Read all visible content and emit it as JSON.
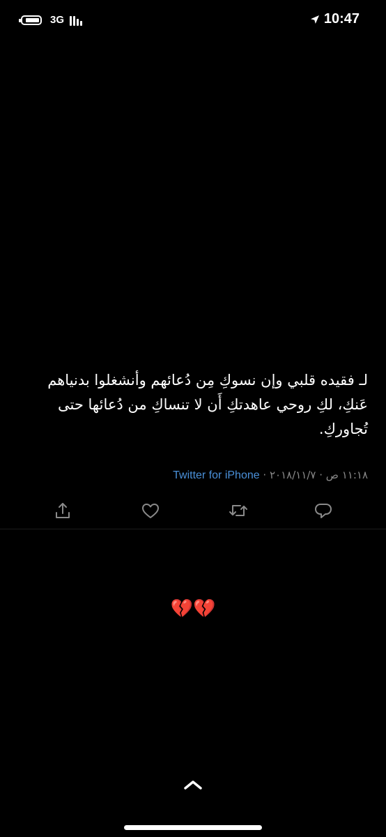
{
  "status_bar": {
    "battery_level": 0.85,
    "network": "3G",
    "time": "10:47",
    "icons": [
      "battery-icon",
      "signal-icon",
      "location-arrow-icon"
    ]
  },
  "tweet": {
    "line1": "لـ فقيده قلبي وإن نسوكِ مِن دُعائهم وأنشغلوا بدنياهم",
    "line2": "عَنكِ، لكِ روحي عاهدتكِ أَن لا تنساكِ من دُعائها حتى",
    "line3": "تُجاوركِ.",
    "timestamp": "١١:١٨ ص · ٢٠١٨/١١/٧",
    "separator": "·",
    "source": "Twitter for iPhone",
    "actions": [
      "share-icon",
      "like-icon",
      "retweet-icon",
      "reply-icon"
    ]
  },
  "reply": {
    "emoji": "💔💔"
  },
  "colors": {
    "background": "#000000",
    "text": "#ffffff",
    "meta": "#8a8a8a",
    "link": "#4a90d9",
    "icon": "#8a8a8a"
  }
}
